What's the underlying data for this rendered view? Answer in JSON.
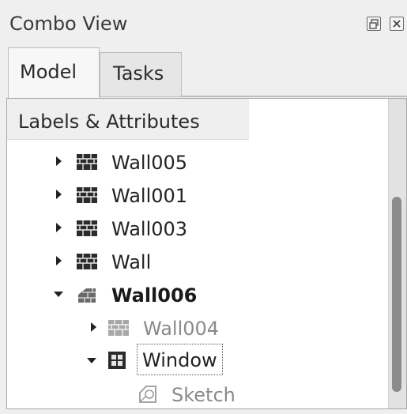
{
  "window": {
    "title": "Combo View"
  },
  "tabs": [
    {
      "label": "Model",
      "active": true
    },
    {
      "label": "Tasks",
      "active": false
    }
  ],
  "tree": {
    "header": "Labels & Attributes",
    "items": [
      {
        "label": "Wall005",
        "icon": "wall-icon",
        "expanded": false,
        "level": 1,
        "style": "normal"
      },
      {
        "label": "Wall001",
        "icon": "wall-icon",
        "expanded": false,
        "level": 1,
        "style": "normal"
      },
      {
        "label": "Wall003",
        "icon": "wall-icon",
        "expanded": false,
        "level": 1,
        "style": "normal"
      },
      {
        "label": "Wall",
        "icon": "wall-icon",
        "expanded": false,
        "level": 1,
        "style": "normal"
      },
      {
        "label": "Wall006",
        "icon": "wall-icon",
        "expanded": true,
        "level": 1,
        "style": "bold"
      },
      {
        "label": "Wall004",
        "icon": "wall-icon",
        "expanded": false,
        "level": 2,
        "style": "dimmed"
      },
      {
        "label": "Window",
        "icon": "window-icon",
        "expanded": true,
        "level": 2,
        "style": "selected"
      },
      {
        "label": "Sketch",
        "icon": "sketch-icon",
        "expanded": false,
        "level": 3,
        "style": "dimmed"
      }
    ]
  },
  "colors": {
    "panel_bg": "#ffffff",
    "chrome_bg": "#efefef",
    "dim_text": "#8a8a8a",
    "scroll_thumb": "#8c8c8c"
  }
}
